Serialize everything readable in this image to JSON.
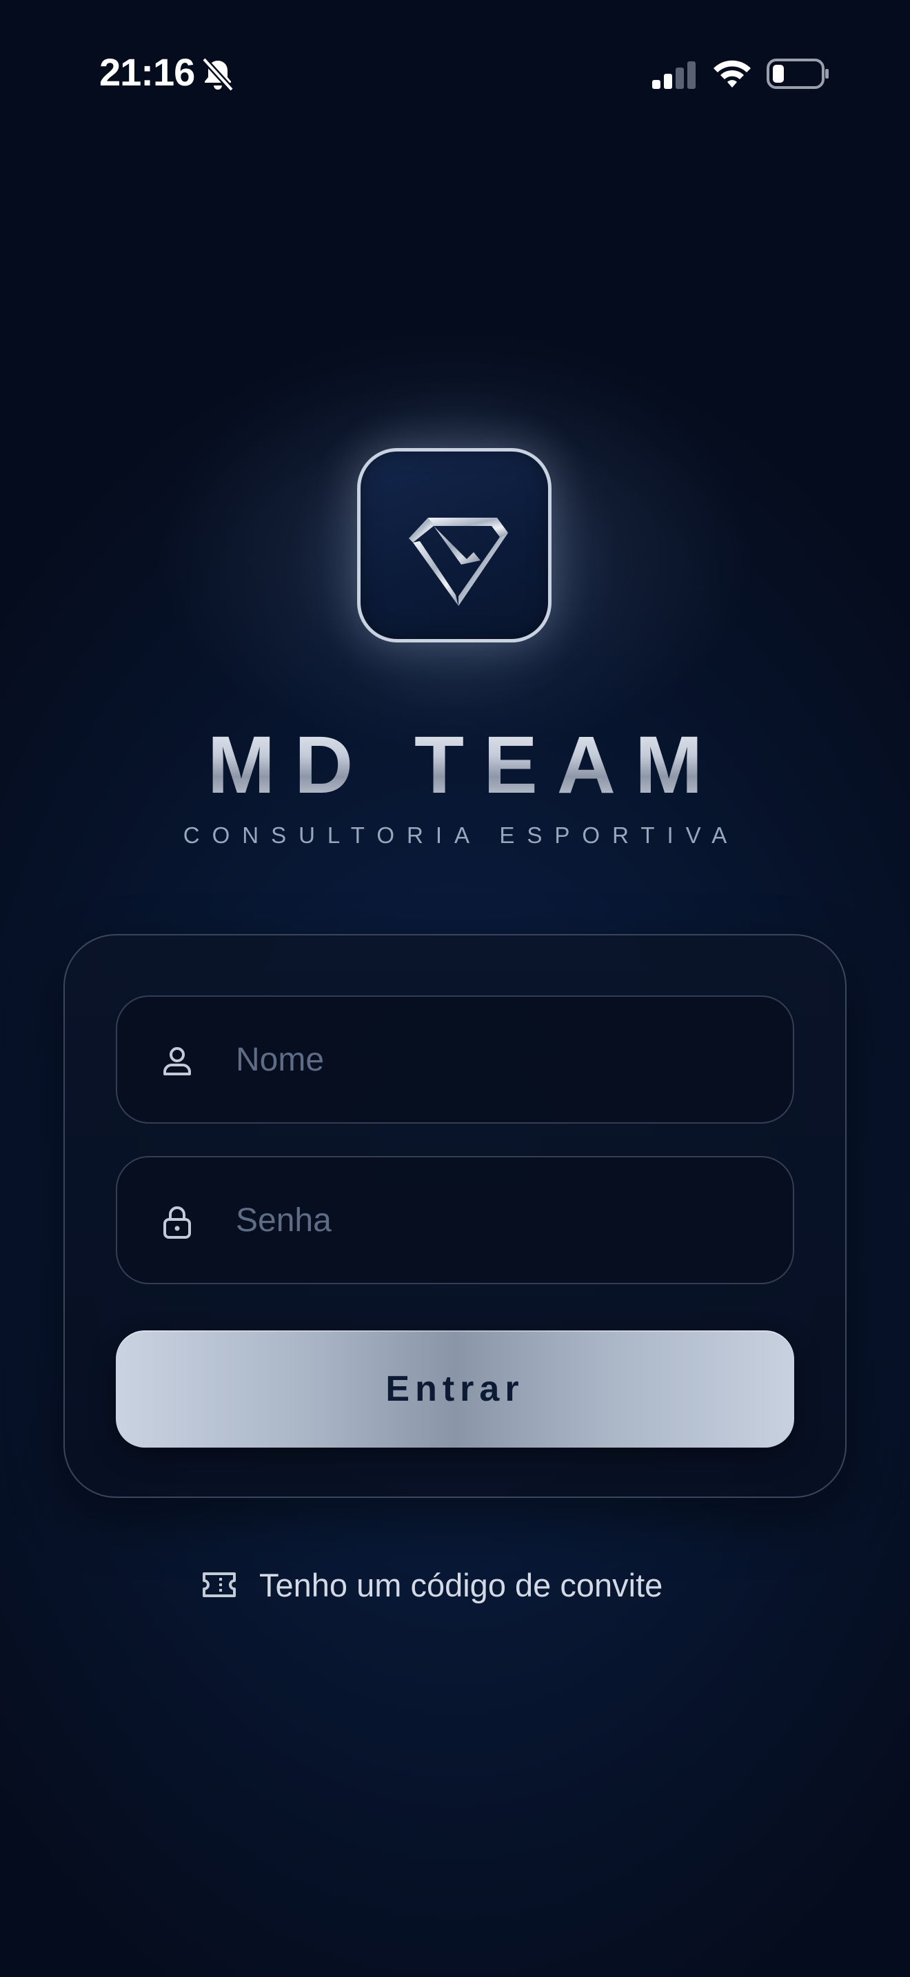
{
  "status_bar": {
    "time": "21:16",
    "icons": [
      "bell-slash-icon",
      "cellular-signal-icon",
      "wifi-icon",
      "battery-icon"
    ]
  },
  "brand": {
    "logo_icon": "diamond-logo-icon",
    "title": "MD TEAM",
    "subtitle": "CONSULTORIA ESPORTIVA"
  },
  "login_form": {
    "name_field": {
      "placeholder": "Nome",
      "value": "",
      "icon": "user-icon"
    },
    "password_field": {
      "placeholder": "Senha",
      "value": "",
      "icon": "lock-icon"
    },
    "submit_label": "Entrar"
  },
  "invite": {
    "label": "Tenho um código de convite",
    "icon": "ticket-icon"
  },
  "colors": {
    "background_dark": "#050c1d",
    "background_mid": "#0b1f45",
    "accent_silver": "#c9d2e0",
    "button_text": "#0d1a33",
    "placeholder": "#5e6c86"
  }
}
